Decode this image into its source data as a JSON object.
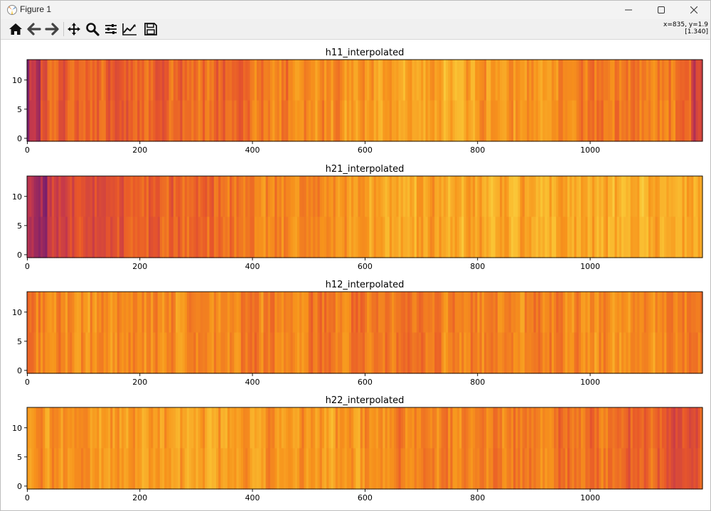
{
  "window": {
    "title": "Figure 1"
  },
  "toolbar": {
    "buttons": [
      {
        "name": "home-icon"
      },
      {
        "name": "back-icon"
      },
      {
        "name": "forward-icon"
      },
      {
        "name": "pan-icon"
      },
      {
        "name": "zoom-icon"
      },
      {
        "name": "configure-subplots-icon"
      },
      {
        "name": "edit-axis-icon"
      },
      {
        "name": "save-icon"
      }
    ],
    "coords_line1": "x=835, y=1.9",
    "coords_line2": "[1.340]"
  },
  "colors": {
    "heat_low": "#7a1e6c",
    "heat_mid": "#e8572a",
    "heat_high": "#f7e86a"
  },
  "chart_data": [
    {
      "type": "heatmap",
      "title": "h11_interpolated",
      "xlim": [
        0,
        1199
      ],
      "ylim": [
        -0.5,
        13.5
      ],
      "xticks": [
        0,
        200,
        400,
        600,
        800,
        1000
      ],
      "yticks": [
        0,
        5,
        10
      ],
      "pattern": "dark purple-red at left edge, orange body, bright yellow band around x=600-800, dark red at right edge",
      "grid": false
    },
    {
      "type": "heatmap",
      "title": "h21_interpolated",
      "xlim": [
        0,
        1199
      ],
      "ylim": [
        -0.5,
        13.5
      ],
      "xticks": [
        0,
        200,
        400,
        600,
        800,
        1000
      ],
      "yticks": [
        0,
        5,
        10
      ],
      "pattern": "purple-red at left, orange transitioning to yellow-orange toward right",
      "grid": false
    },
    {
      "type": "heatmap",
      "title": "h12_interpolated",
      "xlim": [
        0,
        1199
      ],
      "ylim": [
        -0.5,
        13.5
      ],
      "xticks": [
        0,
        200,
        400,
        600,
        800,
        1000
      ],
      "yticks": [
        0,
        5,
        10
      ],
      "pattern": "fairly uniform orange with yellow streaks",
      "grid": false
    },
    {
      "type": "heatmap",
      "title": "h22_interpolated",
      "xlim": [
        0,
        1199
      ],
      "ylim": [
        -0.5,
        13.5
      ],
      "xticks": [
        0,
        200,
        400,
        600,
        800,
        1000
      ],
      "yticks": [
        0,
        5,
        10
      ],
      "pattern": "orange with yellow streaks, darker red toward right edge",
      "grid": false
    }
  ]
}
